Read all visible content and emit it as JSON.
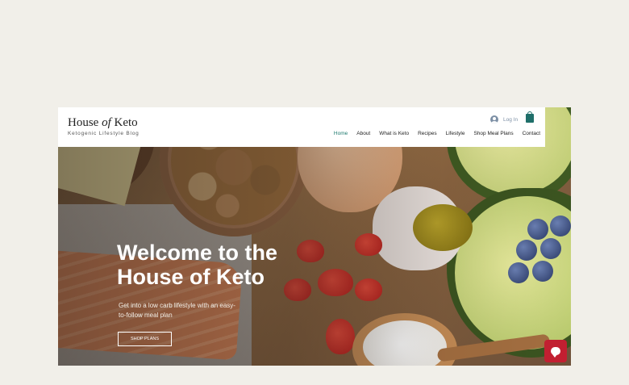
{
  "header": {
    "logo_prefix": "House",
    "logo_of": "of",
    "logo_suffix": "Keto",
    "tagline": "Ketogenic Lifestyle Blog",
    "login_label": "Log In",
    "nav": [
      {
        "label": "Home",
        "active": true
      },
      {
        "label": "About"
      },
      {
        "label": "What is Keto"
      },
      {
        "label": "Recipes"
      },
      {
        "label": "Lifestyle"
      },
      {
        "label": "Shop Meal Plans"
      },
      {
        "label": "Contact"
      }
    ]
  },
  "hero": {
    "title": "Welcome to the House of Keto",
    "subtitle": "Get into a low carb lifestyle with an easy-to-follow meal plan",
    "button_label": "SHOP PLANS"
  },
  "icons": {
    "login": "user-avatar-icon",
    "cart": "shopping-bag-icon",
    "chat": "chat-bubble-icon"
  },
  "colors": {
    "page_bg": "#f1efe9",
    "accent": "#1f7a6f",
    "chat_button": "#c21f31",
    "header_bg": "#ffffff"
  }
}
